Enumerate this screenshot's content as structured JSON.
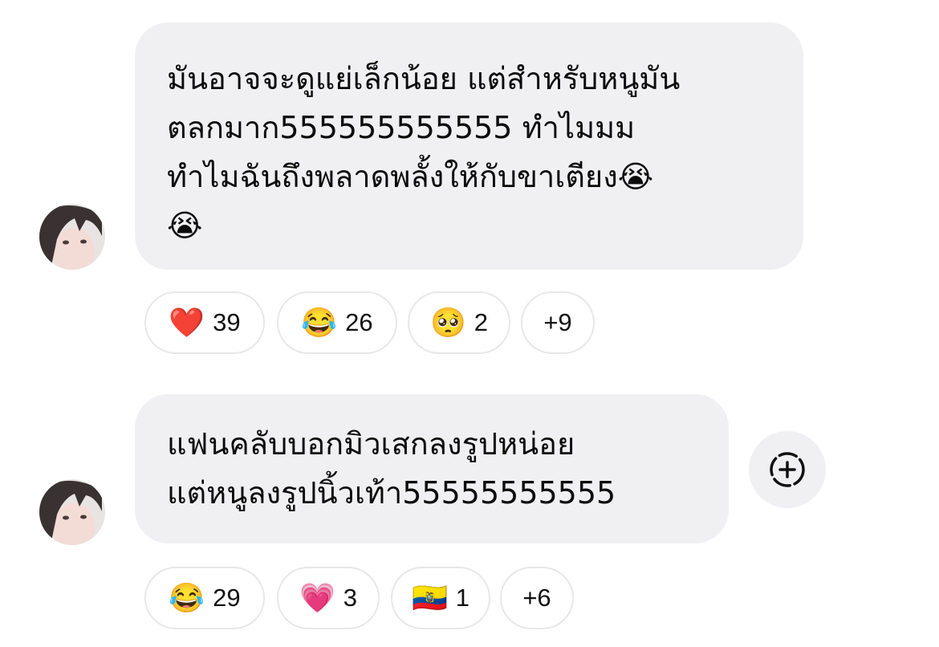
{
  "comments": [
    {
      "text": "มันอาจจะดูแย่เล็กน้อย แต่สำหรับหนูมัน\nตลกมาก555555555555 ทำไมมม\nทำไมฉันถึงพลาดพลั้งให้กับขาเตียง😭\n😭",
      "reactions": [
        {
          "emoji": "❤️",
          "count": "39"
        },
        {
          "emoji": "😂",
          "count": "26"
        },
        {
          "emoji": "🥺",
          "count": "2"
        },
        {
          "more": "+9"
        }
      ]
    },
    {
      "text": "แฟนคลับบอกมิวเสกลงรูปหน่อย\nแต่หนูลงรูปนิ้วเท้า55555555555",
      "reactions": [
        {
          "emoji": "😂",
          "count": "29"
        },
        {
          "emoji": "💗",
          "count": "3"
        },
        {
          "emoji": "🇪🇨",
          "count": "1"
        },
        {
          "more": "+6"
        }
      ]
    }
  ],
  "colors": {
    "bubble": "#f0f0f2",
    "reaction_border": "#e7e7ea",
    "text": "#0b0b0b"
  },
  "icons": {
    "add_reaction": "dashed-circle-plus-icon",
    "avatar": "user-avatar"
  }
}
